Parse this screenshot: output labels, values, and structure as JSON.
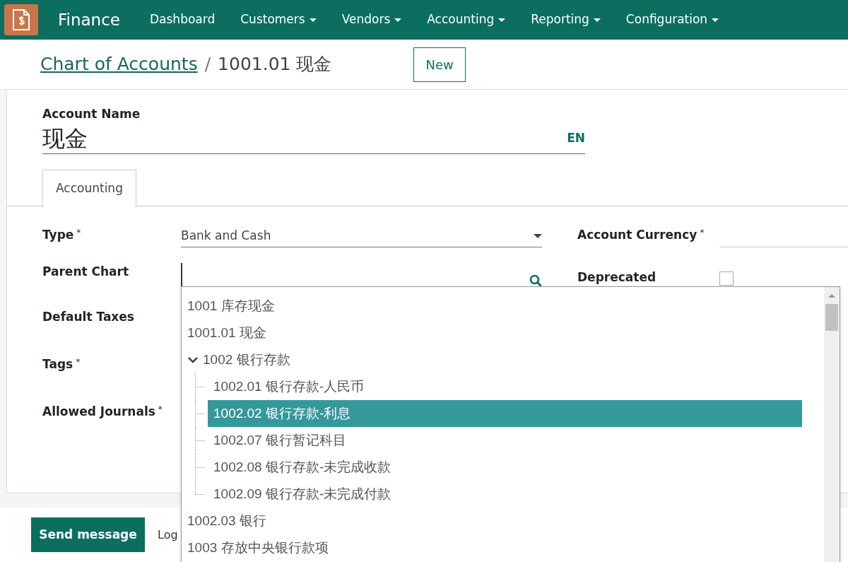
{
  "app": {
    "name": "Finance"
  },
  "menu": [
    {
      "label": "Dashboard",
      "dropdown": false
    },
    {
      "label": "Customers",
      "dropdown": true
    },
    {
      "label": "Vendors",
      "dropdown": true
    },
    {
      "label": "Accounting",
      "dropdown": true
    },
    {
      "label": "Reporting",
      "dropdown": true
    },
    {
      "label": "Configuration",
      "dropdown": true
    }
  ],
  "breadcrumb": [
    {
      "label": "Chart of Accounts"
    },
    {
      "label": "1001.01 现金"
    }
  ],
  "breadcrumb_separator": "/",
  "required_mark": "*",
  "new_button": "New",
  "account_name": {
    "label": "Account Name",
    "value": "现金",
    "lang": "EN"
  },
  "tabs": [
    {
      "label": "Accounting",
      "selected": true
    }
  ],
  "left_fields": [
    {
      "label": "Type",
      "required": true,
      "kind": "select",
      "value": "Bank and Cash"
    },
    {
      "label": "Parent Chart",
      "required": false,
      "kind": "search"
    },
    {
      "label": "Default Taxes",
      "required": false,
      "kind": "hidden"
    },
    {
      "label": "Tags",
      "required": true,
      "kind": "hidden"
    },
    {
      "label": "Allowed Journals",
      "required": true,
      "kind": "hidden"
    }
  ],
  "right_fields": [
    {
      "label": "Account Currency",
      "required": true,
      "kind": "text"
    },
    {
      "label": "Deprecated",
      "required": false,
      "kind": "checkbox",
      "checked": false
    }
  ],
  "dropdown": {
    "items": [
      {
        "label": "1001 库存现金",
        "selected": false
      },
      {
        "label": "1001.01 现金",
        "selected": false
      },
      {
        "label": "1002 银行存款",
        "selected": false,
        "expanded": true,
        "children": [
          {
            "label": "1002.01 银行存款-人民币",
            "selected": false
          },
          {
            "label": "1002.02 银行存款-利息",
            "selected": true
          },
          {
            "label": "1002.07 银行暂记科目",
            "selected": false
          },
          {
            "label": "1002.08 银行存款-未完成收款",
            "selected": false
          },
          {
            "label": "1002.09 银行存款-未完成付款",
            "selected": false
          }
        ]
      },
      {
        "label": "1002.03 银行",
        "selected": false
      },
      {
        "label": "1003 存放中央银行款项",
        "selected": false
      }
    ]
  },
  "chatter": {
    "buttons": [
      {
        "label": "Send message",
        "primary": true
      },
      {
        "label": "Log",
        "primary": false
      }
    ]
  }
}
